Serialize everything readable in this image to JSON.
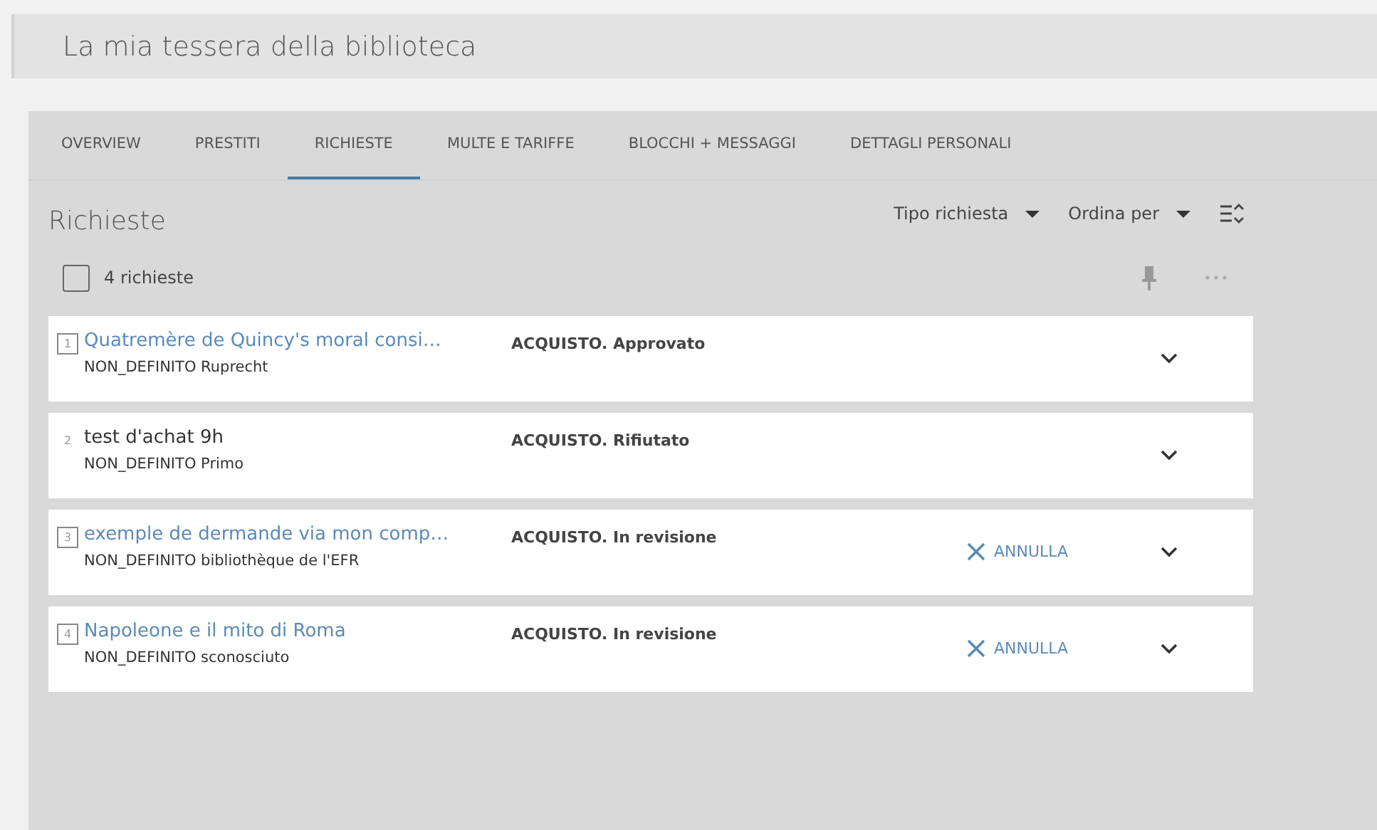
{
  "page_title": "La mia tessera della biblioteca",
  "tabs": [
    {
      "label": "OVERVIEW",
      "selected": false
    },
    {
      "label": "PRESTITI",
      "selected": false
    },
    {
      "label": "RICHIESTE",
      "selected": true
    },
    {
      "label": "MULTE E TARIFFE",
      "selected": false
    },
    {
      "label": "BLOCCHI + MESSAGGI",
      "selected": false
    },
    {
      "label": "DETTAGLI PERSONALI",
      "selected": false
    }
  ],
  "section_title": "Richieste",
  "filters": [
    "Tipo richiesta",
    "Ordina per"
  ],
  "select_all": {
    "label": "4 richieste",
    "checked": false
  },
  "requests": [
    {
      "number": "1",
      "title": "Quatremère de Quincy's moral consi…",
      "linked": true,
      "subtitle": "NON_DEFINITO Ruprecht",
      "status": "ACQUISTO. Approvato"
    },
    {
      "number": "2",
      "title": "test d'achat 9h",
      "linked": false,
      "subtitle": "NON_DEFINITO Primo",
      "status": "ACQUISTO. Rifiutato"
    },
    {
      "number": "3",
      "title": "exemple de dermande via mon comp…",
      "linked": true,
      "subtitle": "NON_DEFINITO bibliothèque de l'EFR",
      "status": "ACQUISTO. In revisione",
      "action": "ANNULLA"
    },
    {
      "number": "4",
      "title": "Napoleone e il mito di Roma",
      "linked": true,
      "subtitle": "NON_DEFINITO sconosciuto",
      "status": "ACQUISTO. In revisione",
      "action": "ANNULLA"
    }
  ]
}
